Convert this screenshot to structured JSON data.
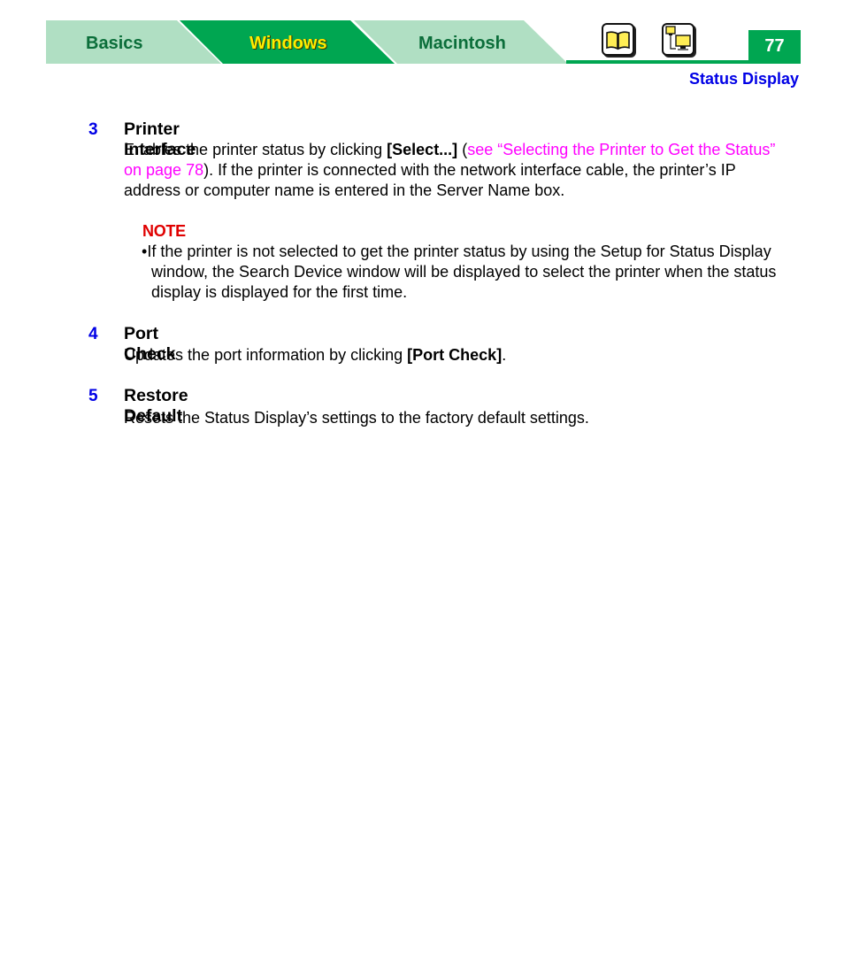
{
  "header": {
    "tabs": [
      {
        "label": "Basics",
        "active": false
      },
      {
        "label": "Windows",
        "active": true
      },
      {
        "label": "Macintosh",
        "active": false
      }
    ],
    "icons": [
      "book-icon",
      "network-computer-icon"
    ],
    "page_number": "77",
    "section_title": "Status Display",
    "colors": {
      "tab_light": "#b0dfc3",
      "tab_dark": "#00a651",
      "tab_text": "#0b6e3a",
      "active_tab_text": "#ffec00",
      "section_title": "#0000e6",
      "link": "#ff00ff",
      "note": "#e00000"
    }
  },
  "items": [
    {
      "number": "3",
      "title": "Printer Interface",
      "text_before": "Enables the printer status by clicking ",
      "bold": "[Select...]",
      "text_paren_open": " (",
      "link": "see “Selecting the Printer to Get the Status” on page 78",
      "text_after": "). If the printer is connected with the network interface cable, the printer’s IP address or computer name is entered in the Server Name box."
    },
    {
      "number": "4",
      "title": "Port Check",
      "text_before": "Updates the port information by clicking ",
      "bold": "[Port Check]",
      "text_after": "."
    },
    {
      "number": "5",
      "title": "Restore Default",
      "text": "Resets the Status Display’s settings to the factory default settings."
    }
  ],
  "note": {
    "label": "NOTE",
    "bullet": "•",
    "text": "If the printer is not selected to get the printer status by using the Setup for Status Display window, the Search Device window will be displayed to select the printer when the status display is displayed for the first time."
  }
}
